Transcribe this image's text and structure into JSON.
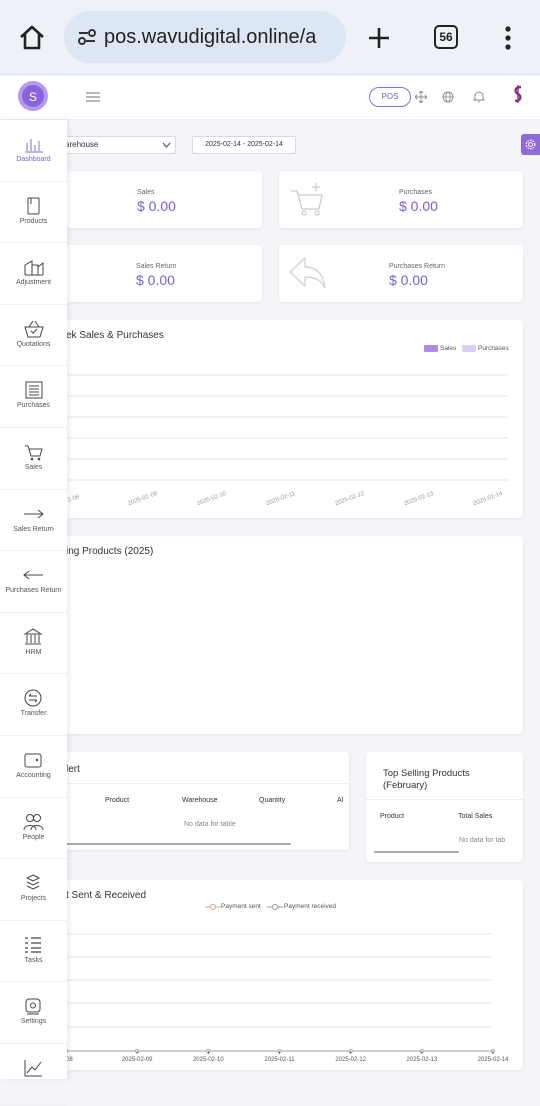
{
  "browser": {
    "url": "pos.wavudigital.online/a",
    "tab_count": "56"
  },
  "header": {
    "pos_label": "POS",
    "logo_letter": "S"
  },
  "sidebar": {
    "items": [
      {
        "label": "Dashboard",
        "icon": "bar-chart-icon",
        "active": true
      },
      {
        "label": "Products",
        "icon": "box-icon"
      },
      {
        "label": "Adjustment",
        "icon": "adjustment-icon"
      },
      {
        "label": "Quotations",
        "icon": "basket-icon"
      },
      {
        "label": "Purchases",
        "icon": "list-icon"
      },
      {
        "label": "Sales",
        "icon": "cart-icon"
      },
      {
        "label": "Sales Return",
        "icon": "arrow-right-icon"
      },
      {
        "label": "Purchases Return",
        "icon": "arrow-left-icon"
      },
      {
        "label": "HRM",
        "icon": "building-icon"
      },
      {
        "label": "Transfer",
        "icon": "transfer-icon"
      },
      {
        "label": "Accounting",
        "icon": "wallet-icon"
      },
      {
        "label": "People",
        "icon": "people-icon"
      },
      {
        "label": "Projects",
        "icon": "cubes-icon"
      },
      {
        "label": "Tasks",
        "icon": "tasks-icon"
      },
      {
        "label": "Settings",
        "icon": "settings-icon"
      },
      {
        "label": "",
        "icon": "report-chart-icon"
      }
    ]
  },
  "filters": {
    "warehouse": "arehouse",
    "date_range": "2025-02-14 - 2025-02-14"
  },
  "stats": {
    "sales_label": "Sales",
    "sales_value": "$ 0.00",
    "purchases_label": "Purchases",
    "purchases_value": "$ 0.00",
    "sales_return_label": "Sales Return",
    "sales_return_value": "$ 0.00",
    "purchases_return_label": "Purchases Return",
    "purchases_return_value": "$ 0.00"
  },
  "weekly_chart": {
    "title": "ek Sales & Purchases",
    "legend_sales": "Sales",
    "legend_purchases": "Purchases",
    "ticks": [
      "2-08",
      "2025-02-09",
      "2025-02-10",
      "2025-02-11",
      "2025-02-12",
      "2025-02-13",
      "2025-02-14"
    ]
  },
  "top_products_year": {
    "title": "ing Products (2025)"
  },
  "stock_alert": {
    "title": "lert",
    "columns": [
      "Product",
      "Warehouse",
      "Quantity",
      "Al"
    ],
    "empty": "No data for table"
  },
  "top_products_month": {
    "title_line1": "Top Selling Products",
    "title_line2": "(February)",
    "columns": [
      "Product",
      "Total Sales"
    ],
    "empty": "No data for tab"
  },
  "payment_chart": {
    "title": "t Sent & Received",
    "legend_sent": "Payment sent",
    "legend_received": "Payment received",
    "ticks": [
      "08",
      "2025-02-09",
      "2025-02-10",
      "2025-02-11",
      "2025-02-12",
      "2025-02-13",
      "2025-02-14"
    ]
  },
  "colors": {
    "accent": "#7b5fd0",
    "sales_series": "#a98ee8",
    "purchases_series": "#d9cff5"
  },
  "chart_data": [
    {
      "type": "bar",
      "title": "ek Sales & Purchases",
      "categories": [
        "2-08",
        "2025-02-09",
        "2025-02-10",
        "2025-02-11",
        "2025-02-12",
        "2025-02-13",
        "2025-02-14"
      ],
      "series": [
        {
          "name": "Sales",
          "values": [
            0,
            0,
            0,
            0,
            0,
            0,
            0
          ]
        },
        {
          "name": "Purchases",
          "values": [
            0,
            0,
            0,
            0,
            0,
            0,
            0
          ]
        }
      ],
      "grid": true,
      "legend": "top-right"
    },
    {
      "type": "line",
      "title": "t Sent & Received",
      "categories": [
        "08",
        "2025-02-09",
        "2025-02-10",
        "2025-02-11",
        "2025-02-12",
        "2025-02-13",
        "2025-02-14"
      ],
      "series": [
        {
          "name": "Payment sent",
          "values": [
            0,
            0,
            0,
            0,
            0,
            0,
            0
          ]
        },
        {
          "name": "Payment received",
          "values": [
            0,
            0,
            0,
            0,
            0,
            0,
            0
          ]
        }
      ],
      "grid": true,
      "legend": "top-center"
    }
  ]
}
